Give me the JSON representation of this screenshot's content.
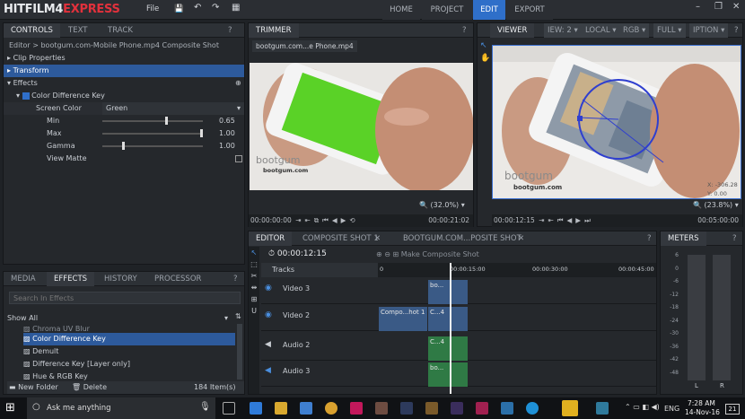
{
  "app": {
    "logo_left": "HITFILM4",
    "logo_right": "EXPRESS"
  },
  "menu": {
    "file": "File"
  },
  "topnav": {
    "home": "HOME",
    "project": "PROJECT",
    "edit": "EDIT",
    "export": "EXPORT"
  },
  "controls": {
    "tabs": [
      "CONTROLS",
      "TEXT",
      "TRACK"
    ],
    "breadcrumb": "Editor > bootgum.com-Mobile Phone.mp4 Composite Shot",
    "clip_properties": "Clip Properties",
    "transform": "Transform",
    "effects": "Effects",
    "effect_name": "Color Difference Key",
    "screen_color_label": "Screen Color",
    "screen_color_value": "Green",
    "min_label": "Min",
    "min_value": "0.65",
    "max_label": "Max",
    "max_value": "1.00",
    "gamma_label": "Gamma",
    "gamma_value": "1.00",
    "view_matte_label": "View Matte"
  },
  "trimmer": {
    "title": "TRIMMER",
    "clip_tab": "bootgum.com...e Phone.mp4",
    "zoom": "(32.0%)",
    "time_start": "00:00:00:00",
    "time_end": "00:00:21:02",
    "watermark": "bootgum",
    "watermark_sub": "bootgum.com"
  },
  "viewer": {
    "title": "VIEWER",
    "dropdowns": [
      "IEW: 2",
      "LOCAL",
      "RGB",
      "FULL",
      "IPTION"
    ],
    "zoom": "(23.8%)",
    "time_current": "00:00:12:15",
    "time_end": "00:05:00:00",
    "coord_x": "X:  -306.28",
    "coord_y": "Y:     0.00",
    "watermark": "bootgum",
    "watermark_sub": "bootgum.com"
  },
  "editor": {
    "tabs": [
      "EDITOR",
      "COMPOSITE SHOT 1",
      "BOOTGUM.COM...POSITE SHOT"
    ],
    "timecode": "00:00:12:15",
    "make_composite": "Make Composite Shot",
    "tracks_label": "Tracks",
    "ruler": [
      "0",
      "00:00:15:00",
      "00:00:30:00",
      "00:00:45:00"
    ],
    "tracks": [
      "Video 3",
      "Video 2",
      "Audio 2",
      "Audio 3"
    ],
    "clips": {
      "v3": "bo...",
      "v2a": "Compo...hot 1",
      "v2b": "C...4",
      "a2": "C...4",
      "a3": "bo..."
    }
  },
  "meters": {
    "title": "METERS",
    "scale": [
      "6",
      "0",
      "-6",
      "-12",
      "-18",
      "-24",
      "-30",
      "-36",
      "-42",
      "-48"
    ],
    "left": "L",
    "right": "R"
  },
  "media": {
    "tabs": [
      "MEDIA",
      "EFFECTS",
      "HISTORY",
      "PROCESSOR"
    ],
    "search_placeholder": "Search In Effects",
    "show_all": "Show All",
    "items": [
      "Chroma UV Blur",
      "Color Difference Key",
      "Demult",
      "Difference Key [Layer only]",
      "Hue & RGB Key"
    ],
    "new_folder": "New Folder",
    "delete": "Delete",
    "count": "184 Item(s)"
  },
  "taskbar": {
    "search": "Ask me anything",
    "lang": "ENG",
    "time": "7:28 AM",
    "date": "14-Nov-16",
    "notif": "21"
  }
}
